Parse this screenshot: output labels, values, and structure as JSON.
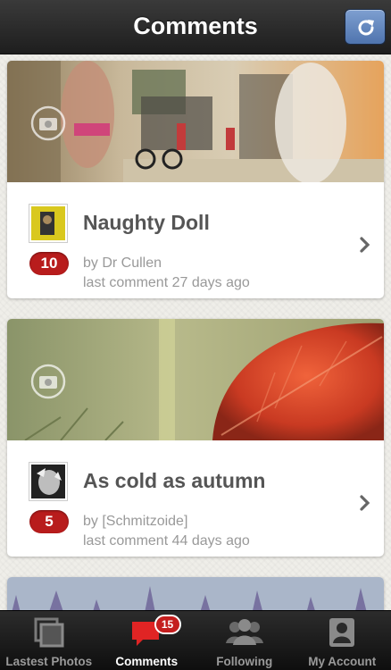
{
  "header": {
    "title": "Comments",
    "refresh_icon": "refresh-icon"
  },
  "feed": {
    "items": [
      {
        "title": "Naughty Doll",
        "comment_count": "10",
        "author": "by Dr Cullen",
        "last_comment": "last comment 27 days ago"
      },
      {
        "title": "As cold as autumn",
        "comment_count": "5",
        "author": "by [Schmitzoide]",
        "last_comment": "last comment 44 days ago"
      }
    ]
  },
  "tabbar": {
    "tabs": [
      {
        "label": "Lastest Photos",
        "icon": "photos-icon",
        "active": false
      },
      {
        "label": "Comments",
        "icon": "comment-bubble-icon",
        "active": true,
        "badge": "15"
      },
      {
        "label": "Following",
        "icon": "people-icon",
        "active": false
      },
      {
        "label": "My Account",
        "icon": "account-icon",
        "active": false
      }
    ]
  },
  "colors": {
    "badge_red": "#b81c1c",
    "nav_bg": "#2a2a2a",
    "accent_blue": "#5a7fb8"
  }
}
